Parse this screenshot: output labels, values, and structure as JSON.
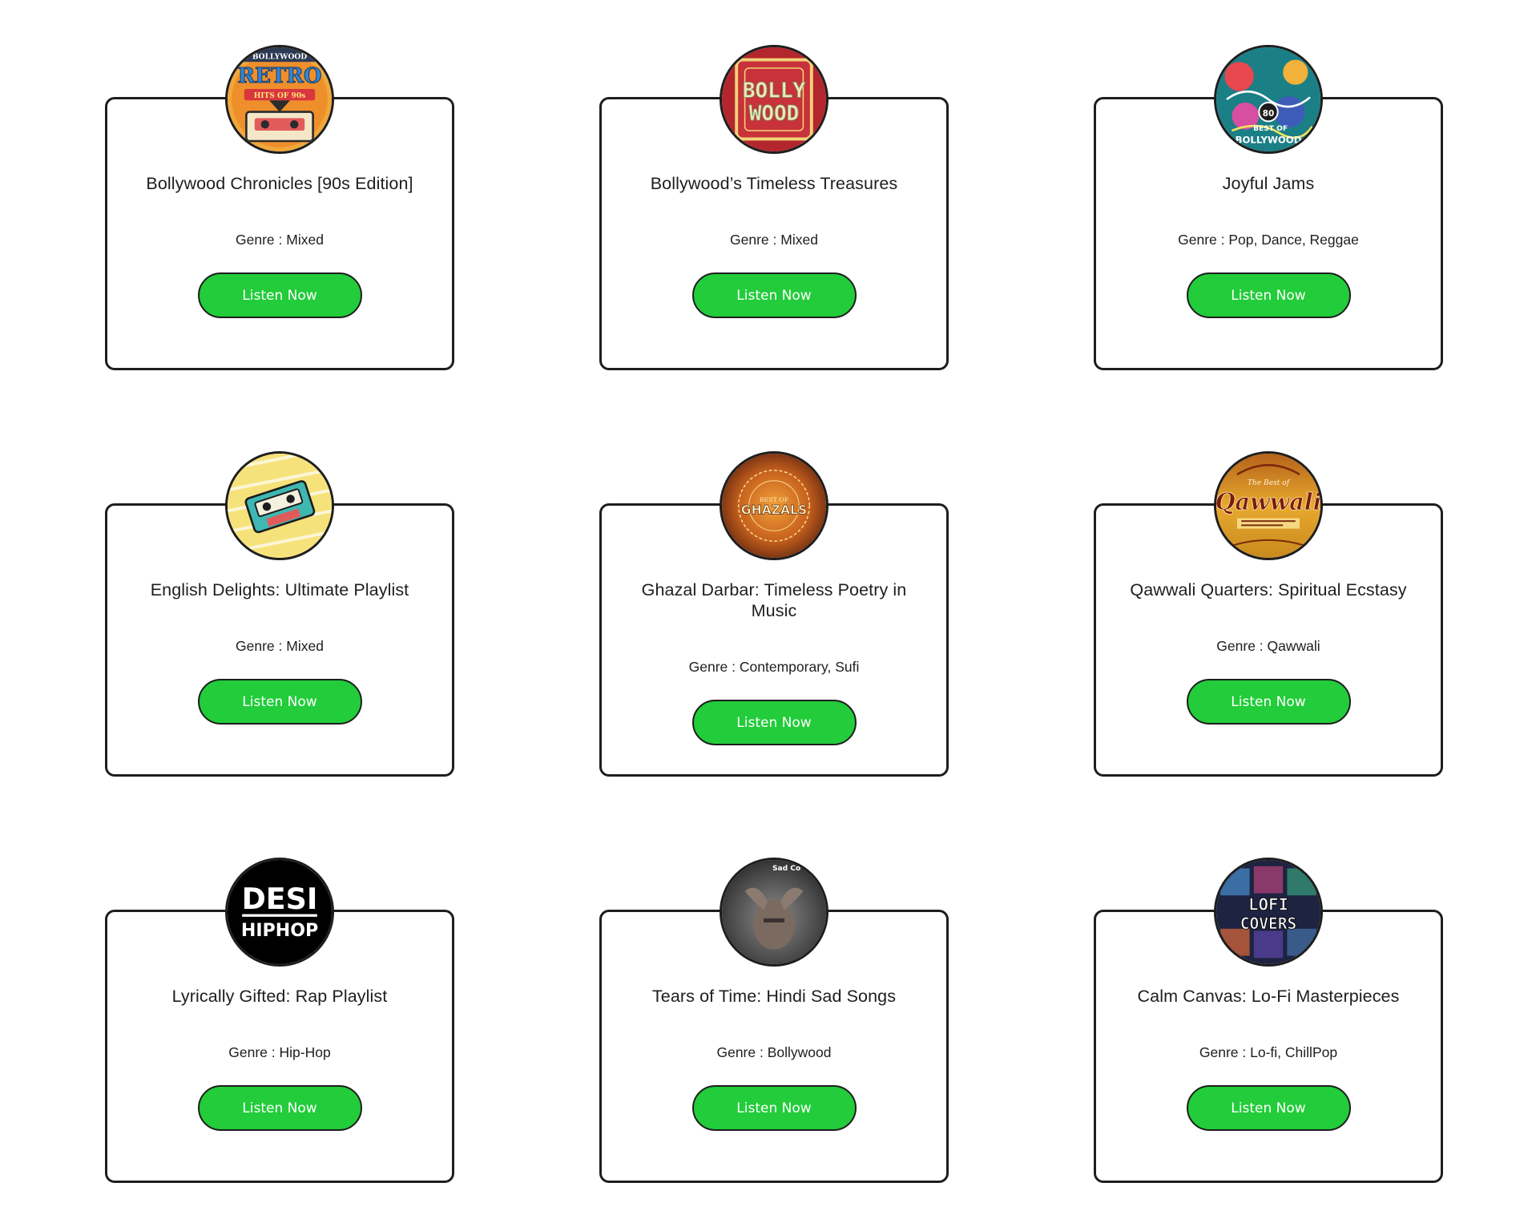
{
  "colors": {
    "button_bg": "#22cc3a",
    "button_text": "#ffffff",
    "border": "#1e1e1e",
    "background": "#ffffff"
  },
  "genre_label": "Genre :",
  "playlists": [
    {
      "title": "Bollywood Chronicles [90s Edition]",
      "genre": "Mixed",
      "button": "Listen Now",
      "cover_icon": "retro-cassette-cover-icon",
      "cover_text": [
        "BOLLYWOOD",
        "RETRO",
        "HITS OF 90s"
      ]
    },
    {
      "title": "Bollywood’s Timeless Treasures",
      "genre": "Mixed",
      "button": "Listen Now",
      "cover_icon": "bollywood-poster-cover-icon",
      "cover_text": [
        "BOLLY",
        "WOOD"
      ]
    },
    {
      "title": "Joyful Jams",
      "genre": "Pop, Dance, Reggae",
      "button": "Listen Now",
      "cover_icon": "best-of-bollywood-doodle-cover-icon",
      "cover_text": [
        "80",
        "BEST OF",
        "BOLLYWOOD"
      ]
    },
    {
      "title": "English Delights: Ultimate Playlist",
      "genre": "Mixed",
      "button": "Listen Now",
      "cover_icon": "cassette-tape-cover-icon",
      "cover_text": []
    },
    {
      "title": "Ghazal Darbar: Timeless Poetry in Music",
      "genre": "Contemporary, Sufi",
      "button": "Listen Now",
      "cover_icon": "ghazals-ornate-cover-icon",
      "cover_text": [
        "BEST OF",
        "GHAZALS"
      ]
    },
    {
      "title": "Qawwali Quarters: Spiritual Ecstasy",
      "genre": "Qawwali",
      "button": "Listen Now",
      "cover_icon": "qawwali-cover-icon",
      "cover_text": [
        "The Best of",
        "Qawwali"
      ]
    },
    {
      "title": "Lyrically Gifted: Rap Playlist",
      "genre": "Hip-Hop",
      "button": "Listen Now",
      "cover_icon": "desi-hiphop-cover-icon",
      "cover_text": [
        "DESI",
        "HIPHOP"
      ]
    },
    {
      "title": "Tears of Time: Hindi Sad Songs",
      "genre": "Bollywood",
      "button": "Listen Now",
      "cover_icon": "sad-portrait-cover-icon",
      "cover_text": [
        "Sad Co"
      ]
    },
    {
      "title": "Calm Canvas: Lo-Fi Masterpieces",
      "genre": "Lo-fi, ChillPop",
      "button": "Listen Now",
      "cover_icon": "lofi-covers-cover-icon",
      "cover_text": [
        "LOFI",
        "COVERS"
      ]
    }
  ]
}
